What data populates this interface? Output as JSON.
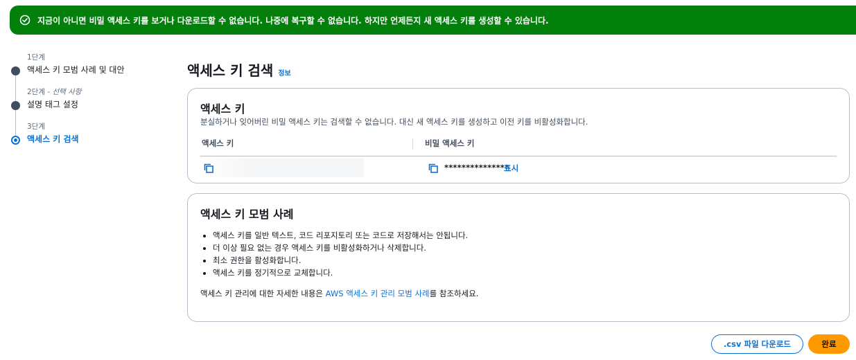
{
  "flash": {
    "message": "지금이 아니면 비밀 액세스 키를 보거나 다운로드할 수 없습니다. 나중에 복구할 수 없습니다. 하지만 언제든지 새 액세스 키를 생성할 수 있습니다.",
    "color": "#037f0c"
  },
  "steps": [
    {
      "number": "1단계",
      "optional": "",
      "title": "액세스 키 모범 사례 및 대안"
    },
    {
      "number": "2단계 - ",
      "optional": "선택 사항",
      "title": "설명 태그 설정"
    },
    {
      "number": "3단계",
      "optional": "",
      "title": "액세스 키 검색"
    }
  ],
  "page": {
    "title": "액세스 키 검색",
    "info_link": "정보"
  },
  "retrieve": {
    "heading": "액세스 키",
    "description": "분실하거나 잊어버린 비밀 액세스 키는 검색할 수 없습니다. 대신 새 액세스 키를 생성하고 이전 키를 비활성화합니다.",
    "col_access_key": "액세스 키",
    "col_secret_key": "비밀 액세스 키",
    "access_key_value": "",
    "secret_masked": "***************",
    "show_label": "표시"
  },
  "best_practices": {
    "heading": "액세스 키 모범 사례",
    "items": [
      "액세스 키를 일반 텍스트, 코드 리포지토리 또는 코드로 저장해서는 안됩니다.",
      "더 이상 필요 없는 경우 액세스 키를 비활성화하거나 삭제합니다.",
      "최소 권한을 활성화합니다.",
      "액세스 키를 정기적으로 교체합니다."
    ],
    "note_prefix": "액세스 키 관리에 대한 자세한 내용은 ",
    "note_link": "AWS 액세스 키 관리 모범 사례",
    "note_suffix": "를 참조하세요."
  },
  "buttons": {
    "download_csv": ".csv 파일 다운로드",
    "done": "완료"
  },
  "colors": {
    "accent": "#0972d3",
    "primary_button": "#ff9900"
  }
}
